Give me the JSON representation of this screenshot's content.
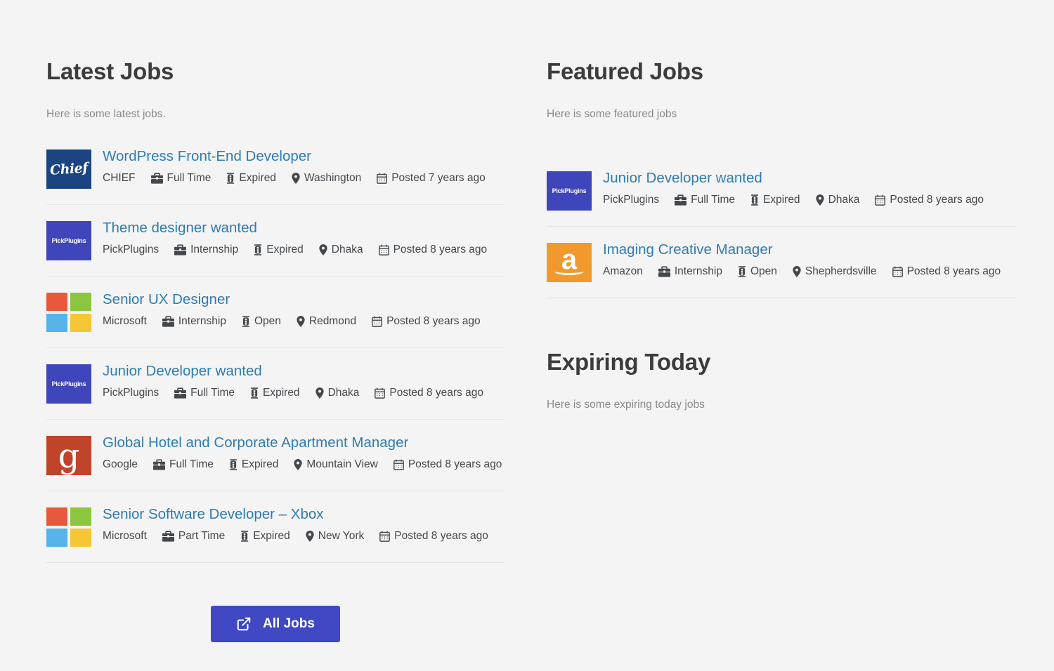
{
  "sections": {
    "latest": {
      "title": "Latest Jobs",
      "description": "Here is some latest jobs.",
      "jobs": [
        {
          "title": "WordPress Front-End Developer",
          "company": "CHIEF",
          "logo": "chief",
          "logo_text": "Chief",
          "type": "Full Time",
          "status": "Expired",
          "location": "Washington",
          "posted": "Posted 7 years ago"
        },
        {
          "title": "Theme designer wanted",
          "company": "PickPlugins",
          "logo": "pickplugins",
          "logo_text": "PickPlugins",
          "type": "Internship",
          "status": "Expired",
          "location": "Dhaka",
          "posted": "Posted 8 years ago"
        },
        {
          "title": "Senior UX Designer",
          "company": "Microsoft",
          "logo": "microsoft",
          "logo_text": "",
          "type": "Internship",
          "status": "Open",
          "location": "Redmond",
          "posted": "Posted 8 years ago"
        },
        {
          "title": "Junior Developer wanted",
          "company": "PickPlugins",
          "logo": "pickplugins",
          "logo_text": "PickPlugins",
          "type": "Full Time",
          "status": "Expired",
          "location": "Dhaka",
          "posted": "Posted 8 years ago"
        },
        {
          "title": "Global Hotel and Corporate Apartment Manager",
          "company": "Google",
          "logo": "google",
          "logo_text": "g",
          "type": "Full Time",
          "status": "Expired",
          "location": "Mountain View",
          "posted": "Posted 8 years ago"
        },
        {
          "title": "Senior Software Developer – Xbox",
          "company": "Microsoft",
          "logo": "microsoft",
          "logo_text": "",
          "type": "Part Time",
          "status": "Expired",
          "location": "New York",
          "posted": "Posted 8 years ago"
        }
      ],
      "all_jobs_button": "All Jobs"
    },
    "featured": {
      "title": "Featured Jobs",
      "description": "Here is some featured jobs",
      "jobs": [
        {
          "title": "Junior Developer wanted",
          "company": "PickPlugins",
          "logo": "pickplugins",
          "logo_text": "PickPlugins",
          "type": "Full Time",
          "status": "Expired",
          "location": "Dhaka",
          "posted": "Posted 8 years ago"
        },
        {
          "title": "Imaging Creative Manager",
          "company": "Amazon",
          "logo": "amazon",
          "logo_text": "a",
          "type": "Internship",
          "status": "Open",
          "location": "Shepherdsville",
          "posted": "Posted 8 years ago"
        }
      ]
    },
    "expiring": {
      "title": "Expiring Today",
      "description": "Here is some expiring today jobs",
      "jobs": []
    }
  },
  "icons": {
    "job_type": "briefcase-icon",
    "job_status": "traffic-light-icon",
    "job_location": "map-marker-icon",
    "job_posted": "calendar-icon",
    "all_jobs_button": "external-link-icon"
  },
  "colors": {
    "page_background": "#f4f4f4",
    "heading": "#3c3c3c",
    "description": "#8a8a8a",
    "job_title_link": "#2f7cb0",
    "meta_text": "#44484c",
    "divider": "#e6e6e6",
    "button_background": "#4048c4",
    "button_text": "#ffffff",
    "logo_chief": "#1b4481",
    "logo_pickplugins": "#3f45ba",
    "logo_google": "#c0442a",
    "logo_amazon": "#f2992e",
    "logo_microsoft_red": "#e8593c",
    "logo_microsoft_green": "#8cc63e",
    "logo_microsoft_blue": "#56b4e8",
    "logo_microsoft_yellow": "#f5c635"
  }
}
